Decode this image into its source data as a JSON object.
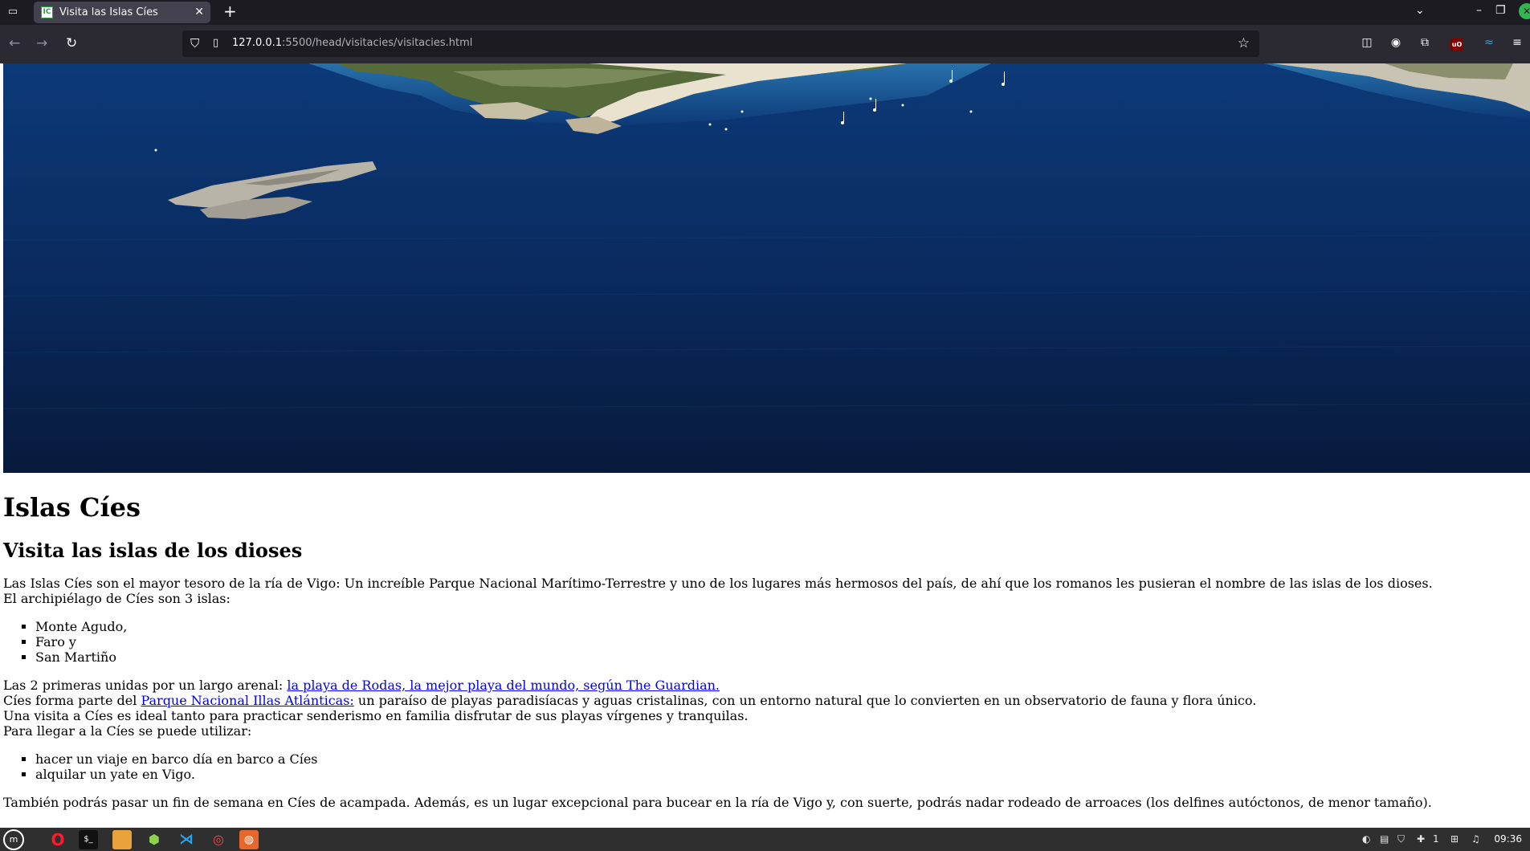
{
  "browser": {
    "tab_title": "Visita las Islas Cíes",
    "favicon_text": "IC",
    "url_host": "127.0.0.1",
    "url_path": ":5500/head/visitacies/visitacies.html"
  },
  "page": {
    "hero_alt": "Vista aérea de las Islas Cíes",
    "heading": "Islas Cíes",
    "subheading": "Visita las islas de los dioses",
    "intro_line1": "Las Islas Cíes son el mayor tesoro de la ría de Vigo: Un increíble Parque Nacional Marítimo-Terrestre y uno de los lugares más hermosos del país, de ahí que los romanos les pusieran el nombre de las islas de los dioses.",
    "intro_line2": "El archipiélago de Cíes son 3 islas:",
    "islands": [
      "Monte Agudo,",
      "Faro y",
      "San Martiño"
    ],
    "rodas_prefix": "Las 2 primeras unidas por un largo arenal: ",
    "rodas_link": "la playa de Rodas, la mejor playa del mundo, según The Guardian.",
    "park_prefix": "Cíes forma parte del ",
    "park_link": "Parque Nacional Illas Atlánticas:",
    "park_suffix": " un paraíso de playas paradisíacas y aguas cristalinas, con un entorno natural que lo convierten en un observatorio de fauna y flora único.",
    "visit_line": "Una visita a Cíes es ideal tanto para practicar senderismo en familia disfrutar de sus playas vírgenes y tranquilas.",
    "travel_line": "Para llegar a la Cíes se puede utilizar:",
    "travel_options": [
      "hacer un viaje en barco día en barco a Cíes",
      "alquilar un yate en Vigo."
    ],
    "closing": "También podrás pasar un fin de semana en Cíes de acampada. Además, es un lugar excepcional para bucear en la ría de Vigo y, con suerte, podrás nadar rodeado de arroaces (los delfines autóctonos, de menor tamaño)."
  },
  "taskbar": {
    "clock": "09:36",
    "tray_count": "1"
  },
  "colors": {
    "link": "#0000ee",
    "sea": "#0b2a5c"
  }
}
